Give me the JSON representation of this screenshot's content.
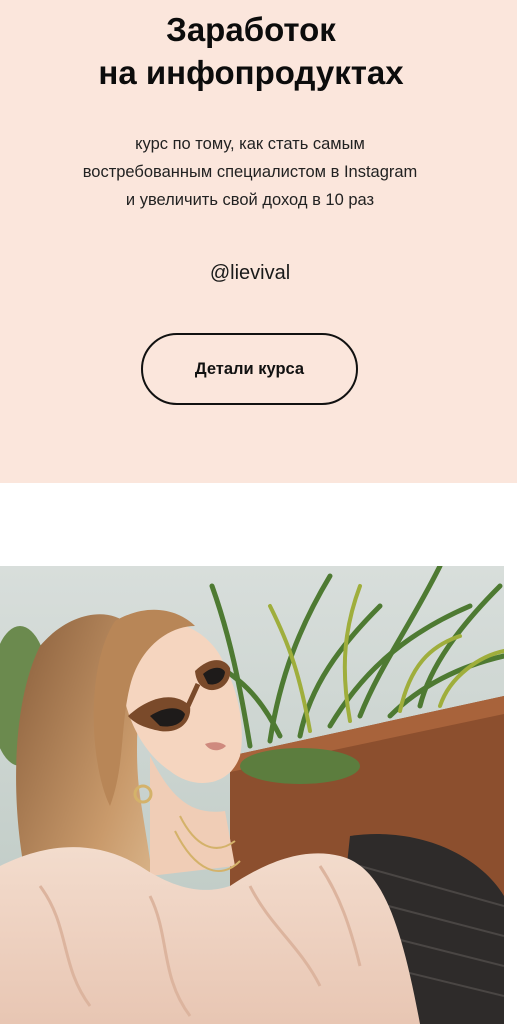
{
  "hero": {
    "title_lines": [
      "Заработок",
      "на инфопродуктах"
    ],
    "subtitle_lines": [
      "курс по тому, как стать самым",
      "востребованным специалистом в Instagram",
      "и увеличить свой доход в 10 раз"
    ],
    "handle": "@lievival",
    "cta_label": "Детали курса"
  },
  "colors": {
    "hero_background": "#fbe6dc",
    "page_background": "#ffffff",
    "text": "#111111"
  },
  "photo": {
    "subject": "woman-in-sunglasses-with-plants"
  }
}
